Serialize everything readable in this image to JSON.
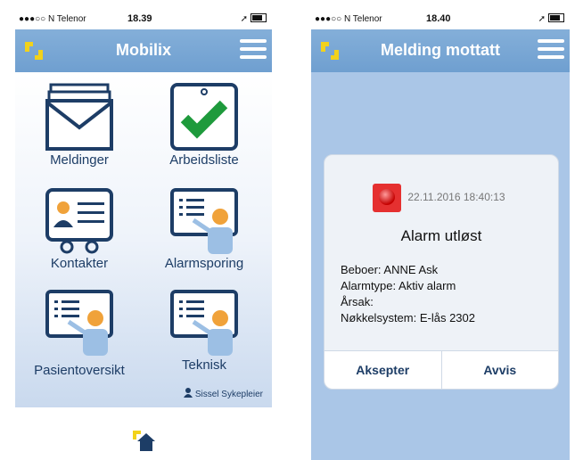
{
  "phone_home": {
    "status": {
      "carrier": "●●●○○ N Telenor",
      "time": "18.39"
    },
    "title": "Mobilix",
    "tiles": [
      {
        "label": "Meldinger",
        "icon": "envelope-stack-icon"
      },
      {
        "label": "Arbeidsliste",
        "icon": "checklist-icon"
      },
      {
        "label": "Kontakter",
        "icon": "contact-card-icon"
      },
      {
        "label": "Alarmsporing",
        "icon": "presentation-person-icon"
      },
      {
        "label": "Pasientoversikt",
        "icon": "presentation-person-icon"
      },
      {
        "label": "Teknisk",
        "icon": "presentation-person-icon"
      }
    ],
    "user": "Sissel Sykepleier"
  },
  "phone_message": {
    "status": {
      "carrier": "●●●○○ N Telenor",
      "time": "18.40"
    },
    "title": "Melding mottatt",
    "timestamp": "22.11.2016 18:40:13",
    "alarm_title": "Alarm utløst",
    "details": [
      "Beboer: ANNE Ask",
      "Alarmtype: Aktiv alarm",
      "Årsak:",
      "Nøkkelsystem: E-lås 2302"
    ],
    "accept_label": "Aksepter",
    "reject_label": "Avvis"
  },
  "colors": {
    "navbar": "#7aa8d6",
    "accent_yellow": "#f2d21b",
    "check_green": "#1e9a3c",
    "alarm_red": "#e53030"
  }
}
